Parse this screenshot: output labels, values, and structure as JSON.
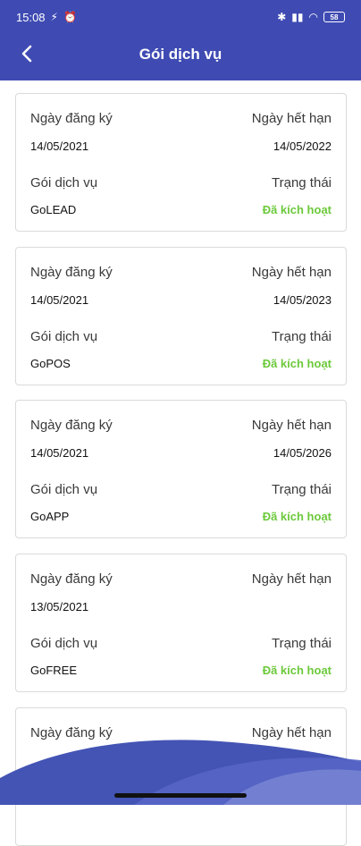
{
  "status_bar": {
    "time": "15:08",
    "battery": "58"
  },
  "header": {
    "title": "Gói dịch vụ"
  },
  "labels": {
    "registration_date": "Ngày đăng ký",
    "expiration_date": "Ngày hết hạn",
    "service_package": "Gói dịch vụ",
    "status": "Trạng thái"
  },
  "packages": [
    {
      "registered": "14/05/2021",
      "expires": "14/05/2022",
      "package": "GoLEAD",
      "status": "Đã kích hoạt"
    },
    {
      "registered": "14/05/2021",
      "expires": "14/05/2023",
      "package": "GoPOS",
      "status": "Đã kích hoạt"
    },
    {
      "registered": "14/05/2021",
      "expires": "14/05/2026",
      "package": "GoAPP",
      "status": "Đã kích hoạt"
    },
    {
      "registered": "13/05/2021",
      "expires": "",
      "package": "GoFREE",
      "status": "Đã kích hoạt"
    },
    {
      "registered": "",
      "expires": "",
      "package": "",
      "status": ""
    }
  ],
  "colors": {
    "primary": "#3f4bb3",
    "status_active": "#6cc93b"
  }
}
